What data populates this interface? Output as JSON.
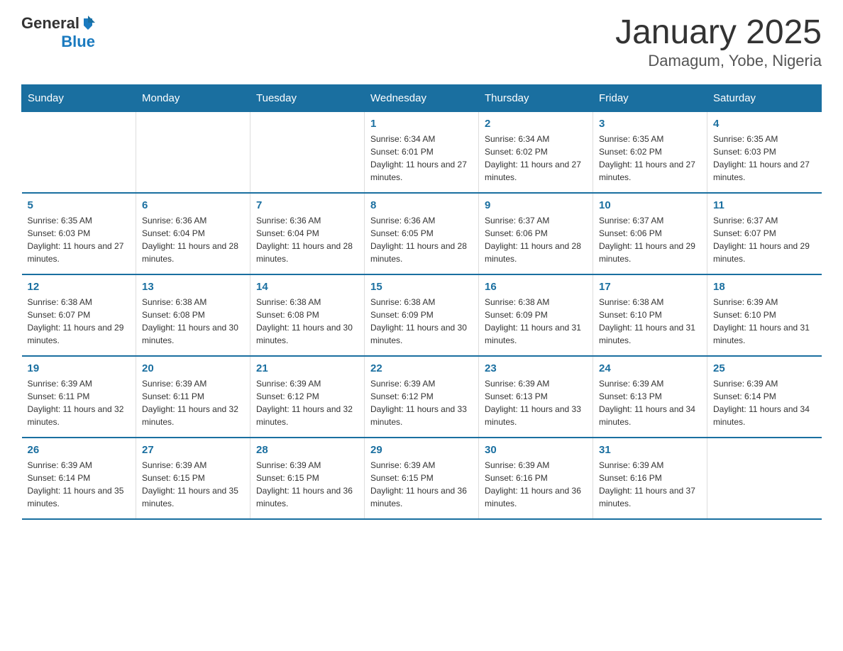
{
  "header": {
    "logo_general": "General",
    "logo_blue": "Blue",
    "title": "January 2025",
    "subtitle": "Damagum, Yobe, Nigeria"
  },
  "calendar": {
    "days_of_week": [
      "Sunday",
      "Monday",
      "Tuesday",
      "Wednesday",
      "Thursday",
      "Friday",
      "Saturday"
    ],
    "weeks": [
      [
        {
          "day": "",
          "info": ""
        },
        {
          "day": "",
          "info": ""
        },
        {
          "day": "",
          "info": ""
        },
        {
          "day": "1",
          "info": "Sunrise: 6:34 AM\nSunset: 6:01 PM\nDaylight: 11 hours and 27 minutes."
        },
        {
          "day": "2",
          "info": "Sunrise: 6:34 AM\nSunset: 6:02 PM\nDaylight: 11 hours and 27 minutes."
        },
        {
          "day": "3",
          "info": "Sunrise: 6:35 AM\nSunset: 6:02 PM\nDaylight: 11 hours and 27 minutes."
        },
        {
          "day": "4",
          "info": "Sunrise: 6:35 AM\nSunset: 6:03 PM\nDaylight: 11 hours and 27 minutes."
        }
      ],
      [
        {
          "day": "5",
          "info": "Sunrise: 6:35 AM\nSunset: 6:03 PM\nDaylight: 11 hours and 27 minutes."
        },
        {
          "day": "6",
          "info": "Sunrise: 6:36 AM\nSunset: 6:04 PM\nDaylight: 11 hours and 28 minutes."
        },
        {
          "day": "7",
          "info": "Sunrise: 6:36 AM\nSunset: 6:04 PM\nDaylight: 11 hours and 28 minutes."
        },
        {
          "day": "8",
          "info": "Sunrise: 6:36 AM\nSunset: 6:05 PM\nDaylight: 11 hours and 28 minutes."
        },
        {
          "day": "9",
          "info": "Sunrise: 6:37 AM\nSunset: 6:06 PM\nDaylight: 11 hours and 28 minutes."
        },
        {
          "day": "10",
          "info": "Sunrise: 6:37 AM\nSunset: 6:06 PM\nDaylight: 11 hours and 29 minutes."
        },
        {
          "day": "11",
          "info": "Sunrise: 6:37 AM\nSunset: 6:07 PM\nDaylight: 11 hours and 29 minutes."
        }
      ],
      [
        {
          "day": "12",
          "info": "Sunrise: 6:38 AM\nSunset: 6:07 PM\nDaylight: 11 hours and 29 minutes."
        },
        {
          "day": "13",
          "info": "Sunrise: 6:38 AM\nSunset: 6:08 PM\nDaylight: 11 hours and 30 minutes."
        },
        {
          "day": "14",
          "info": "Sunrise: 6:38 AM\nSunset: 6:08 PM\nDaylight: 11 hours and 30 minutes."
        },
        {
          "day": "15",
          "info": "Sunrise: 6:38 AM\nSunset: 6:09 PM\nDaylight: 11 hours and 30 minutes."
        },
        {
          "day": "16",
          "info": "Sunrise: 6:38 AM\nSunset: 6:09 PM\nDaylight: 11 hours and 31 minutes."
        },
        {
          "day": "17",
          "info": "Sunrise: 6:38 AM\nSunset: 6:10 PM\nDaylight: 11 hours and 31 minutes."
        },
        {
          "day": "18",
          "info": "Sunrise: 6:39 AM\nSunset: 6:10 PM\nDaylight: 11 hours and 31 minutes."
        }
      ],
      [
        {
          "day": "19",
          "info": "Sunrise: 6:39 AM\nSunset: 6:11 PM\nDaylight: 11 hours and 32 minutes."
        },
        {
          "day": "20",
          "info": "Sunrise: 6:39 AM\nSunset: 6:11 PM\nDaylight: 11 hours and 32 minutes."
        },
        {
          "day": "21",
          "info": "Sunrise: 6:39 AM\nSunset: 6:12 PM\nDaylight: 11 hours and 32 minutes."
        },
        {
          "day": "22",
          "info": "Sunrise: 6:39 AM\nSunset: 6:12 PM\nDaylight: 11 hours and 33 minutes."
        },
        {
          "day": "23",
          "info": "Sunrise: 6:39 AM\nSunset: 6:13 PM\nDaylight: 11 hours and 33 minutes."
        },
        {
          "day": "24",
          "info": "Sunrise: 6:39 AM\nSunset: 6:13 PM\nDaylight: 11 hours and 34 minutes."
        },
        {
          "day": "25",
          "info": "Sunrise: 6:39 AM\nSunset: 6:14 PM\nDaylight: 11 hours and 34 minutes."
        }
      ],
      [
        {
          "day": "26",
          "info": "Sunrise: 6:39 AM\nSunset: 6:14 PM\nDaylight: 11 hours and 35 minutes."
        },
        {
          "day": "27",
          "info": "Sunrise: 6:39 AM\nSunset: 6:15 PM\nDaylight: 11 hours and 35 minutes."
        },
        {
          "day": "28",
          "info": "Sunrise: 6:39 AM\nSunset: 6:15 PM\nDaylight: 11 hours and 36 minutes."
        },
        {
          "day": "29",
          "info": "Sunrise: 6:39 AM\nSunset: 6:15 PM\nDaylight: 11 hours and 36 minutes."
        },
        {
          "day": "30",
          "info": "Sunrise: 6:39 AM\nSunset: 6:16 PM\nDaylight: 11 hours and 36 minutes."
        },
        {
          "day": "31",
          "info": "Sunrise: 6:39 AM\nSunset: 6:16 PM\nDaylight: 11 hours and 37 minutes."
        },
        {
          "day": "",
          "info": ""
        }
      ]
    ]
  }
}
